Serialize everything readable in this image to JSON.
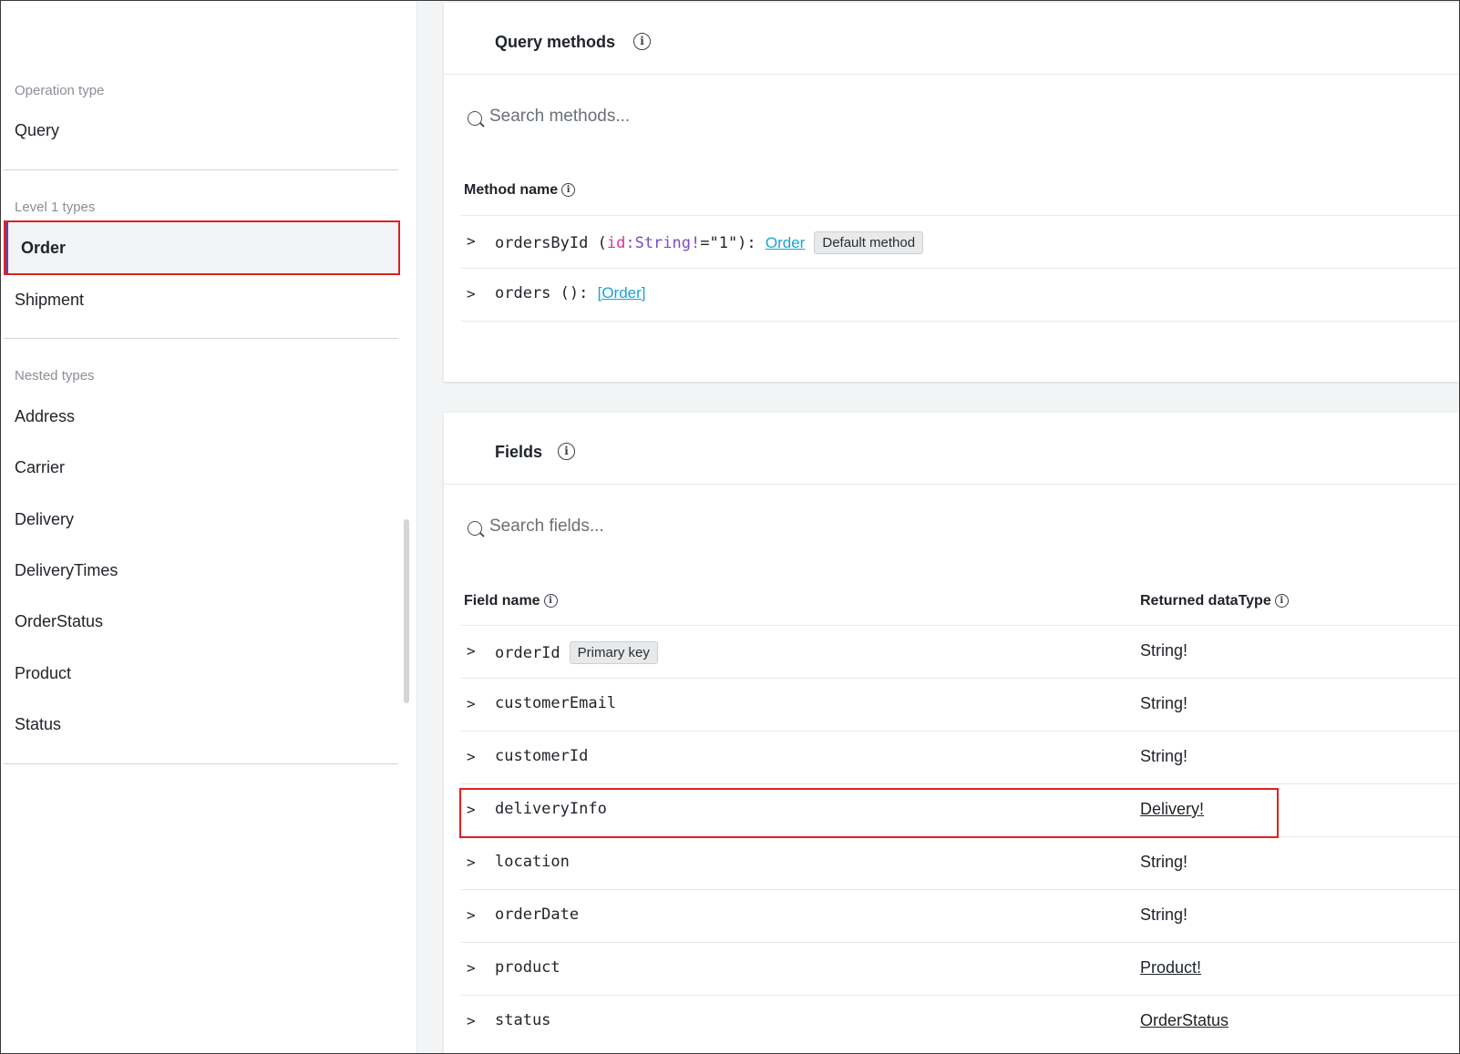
{
  "sidebar": {
    "operation_type": {
      "heading": "Operation type",
      "items": [
        "Query"
      ]
    },
    "level1_types": {
      "heading": "Level 1 types",
      "selected": "Order",
      "items": [
        "Shipment"
      ]
    },
    "nested_types": {
      "heading": "Nested types",
      "items": [
        "Address",
        "Carrier",
        "Delivery",
        "DeliveryTimes",
        "OrderStatus",
        "Product",
        "Status"
      ]
    }
  },
  "query_methods": {
    "title": "Query methods",
    "search_placeholder": "Search methods...",
    "column_method_name": "Method name",
    "methods": [
      {
        "name": "ordersById",
        "open_paren": " (",
        "arg_name": "id",
        "colon": ":",
        "arg_type": "String!",
        "arg_default": "=\"1\"): ",
        "return_type": "Order",
        "badge": "Default method"
      },
      {
        "name": "orders",
        "sig": " (): ",
        "return_type": "[Order]"
      }
    ]
  },
  "fields": {
    "title": "Fields",
    "search_placeholder": "Search fields...",
    "column_field_name": "Field name",
    "column_returned_datatype": "Returned dataType",
    "rows": [
      {
        "name": "orderId",
        "badge": "Primary key",
        "type": "String!",
        "is_link": false
      },
      {
        "name": "customerEmail",
        "type": "String!",
        "is_link": false
      },
      {
        "name": "customerId",
        "type": "String!",
        "is_link": false
      },
      {
        "name": "deliveryInfo",
        "type": "Delivery!",
        "is_link": true
      },
      {
        "name": "location",
        "type": "String!",
        "is_link": false
      },
      {
        "name": "orderDate",
        "type": "String!",
        "is_link": false
      },
      {
        "name": "product",
        "type": "Product!",
        "is_link": true
      },
      {
        "name": "status",
        "type": "OrderStatus",
        "is_link": true
      }
    ]
  },
  "icons": {
    "chevron": ">",
    "info": "i"
  },
  "colors": {
    "highlight": "#e02020",
    "link": "#1aa3d6",
    "selected_accent": "#6b3fa0",
    "arg_name": "#d6339a",
    "arg_type": "#7b4cc2"
  }
}
